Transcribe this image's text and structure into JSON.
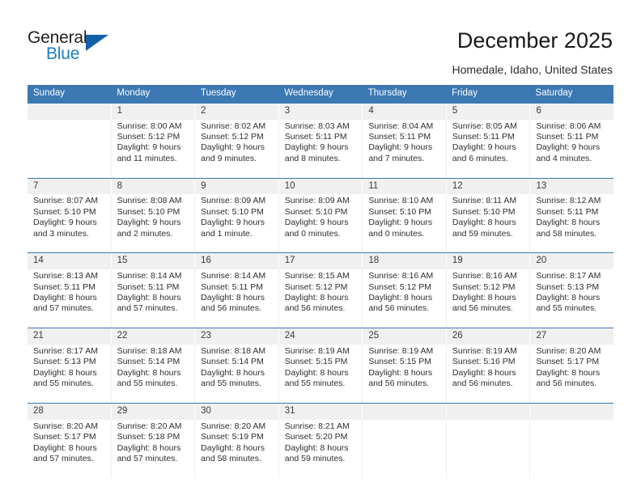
{
  "brand": {
    "name_top": "General",
    "name_bottom": "Blue",
    "triangle_color": "#1061A8",
    "blue_text_color": "#1D7DC4"
  },
  "header": {
    "title": "December 2025",
    "subtitle": "Homedale, Idaho, United States"
  },
  "theme": {
    "header_row_bg": "#3B78B4",
    "header_row_text": "#FFFFFF",
    "day_number_bg": "#F0F0F0",
    "row_divider": "#3B78B4",
    "body_text": "#2E2E2E"
  },
  "calendar": {
    "weekdays": [
      "Sunday",
      "Monday",
      "Tuesday",
      "Wednesday",
      "Thursday",
      "Friday",
      "Saturday"
    ],
    "weeks": [
      [
        {
          "day": "",
          "lines": []
        },
        {
          "day": "1",
          "lines": [
            "Sunrise: 8:00 AM",
            "Sunset: 5:12 PM",
            "Daylight: 9 hours",
            "and 11 minutes."
          ]
        },
        {
          "day": "2",
          "lines": [
            "Sunrise: 8:02 AM",
            "Sunset: 5:12 PM",
            "Daylight: 9 hours",
            "and 9 minutes."
          ]
        },
        {
          "day": "3",
          "lines": [
            "Sunrise: 8:03 AM",
            "Sunset: 5:11 PM",
            "Daylight: 9 hours",
            "and 8 minutes."
          ]
        },
        {
          "day": "4",
          "lines": [
            "Sunrise: 8:04 AM",
            "Sunset: 5:11 PM",
            "Daylight: 9 hours",
            "and 7 minutes."
          ]
        },
        {
          "day": "5",
          "lines": [
            "Sunrise: 8:05 AM",
            "Sunset: 5:11 PM",
            "Daylight: 9 hours",
            "and 6 minutes."
          ]
        },
        {
          "day": "6",
          "lines": [
            "Sunrise: 8:06 AM",
            "Sunset: 5:11 PM",
            "Daylight: 9 hours",
            "and 4 minutes."
          ]
        }
      ],
      [
        {
          "day": "7",
          "lines": [
            "Sunrise: 8:07 AM",
            "Sunset: 5:10 PM",
            "Daylight: 9 hours",
            "and 3 minutes."
          ]
        },
        {
          "day": "8",
          "lines": [
            "Sunrise: 8:08 AM",
            "Sunset: 5:10 PM",
            "Daylight: 9 hours",
            "and 2 minutes."
          ]
        },
        {
          "day": "9",
          "lines": [
            "Sunrise: 8:09 AM",
            "Sunset: 5:10 PM",
            "Daylight: 9 hours",
            "and 1 minute."
          ]
        },
        {
          "day": "10",
          "lines": [
            "Sunrise: 8:09 AM",
            "Sunset: 5:10 PM",
            "Daylight: 9 hours",
            "and 0 minutes."
          ]
        },
        {
          "day": "11",
          "lines": [
            "Sunrise: 8:10 AM",
            "Sunset: 5:10 PM",
            "Daylight: 9 hours",
            "and 0 minutes."
          ]
        },
        {
          "day": "12",
          "lines": [
            "Sunrise: 8:11 AM",
            "Sunset: 5:10 PM",
            "Daylight: 8 hours",
            "and 59 minutes."
          ]
        },
        {
          "day": "13",
          "lines": [
            "Sunrise: 8:12 AM",
            "Sunset: 5:11 PM",
            "Daylight: 8 hours",
            "and 58 minutes."
          ]
        }
      ],
      [
        {
          "day": "14",
          "lines": [
            "Sunrise: 8:13 AM",
            "Sunset: 5:11 PM",
            "Daylight: 8 hours",
            "and 57 minutes."
          ]
        },
        {
          "day": "15",
          "lines": [
            "Sunrise: 8:14 AM",
            "Sunset: 5:11 PM",
            "Daylight: 8 hours",
            "and 57 minutes."
          ]
        },
        {
          "day": "16",
          "lines": [
            "Sunrise: 8:14 AM",
            "Sunset: 5:11 PM",
            "Daylight: 8 hours",
            "and 56 minutes."
          ]
        },
        {
          "day": "17",
          "lines": [
            "Sunrise: 8:15 AM",
            "Sunset: 5:12 PM",
            "Daylight: 8 hours",
            "and 56 minutes."
          ]
        },
        {
          "day": "18",
          "lines": [
            "Sunrise: 8:16 AM",
            "Sunset: 5:12 PM",
            "Daylight: 8 hours",
            "and 56 minutes."
          ]
        },
        {
          "day": "19",
          "lines": [
            "Sunrise: 8:16 AM",
            "Sunset: 5:12 PM",
            "Daylight: 8 hours",
            "and 56 minutes."
          ]
        },
        {
          "day": "20",
          "lines": [
            "Sunrise: 8:17 AM",
            "Sunset: 5:13 PM",
            "Daylight: 8 hours",
            "and 55 minutes."
          ]
        }
      ],
      [
        {
          "day": "21",
          "lines": [
            "Sunrise: 8:17 AM",
            "Sunset: 5:13 PM",
            "Daylight: 8 hours",
            "and 55 minutes."
          ]
        },
        {
          "day": "22",
          "lines": [
            "Sunrise: 8:18 AM",
            "Sunset: 5:14 PM",
            "Daylight: 8 hours",
            "and 55 minutes."
          ]
        },
        {
          "day": "23",
          "lines": [
            "Sunrise: 8:18 AM",
            "Sunset: 5:14 PM",
            "Daylight: 8 hours",
            "and 55 minutes."
          ]
        },
        {
          "day": "24",
          "lines": [
            "Sunrise: 8:19 AM",
            "Sunset: 5:15 PM",
            "Daylight: 8 hours",
            "and 55 minutes."
          ]
        },
        {
          "day": "25",
          "lines": [
            "Sunrise: 8:19 AM",
            "Sunset: 5:15 PM",
            "Daylight: 8 hours",
            "and 56 minutes."
          ]
        },
        {
          "day": "26",
          "lines": [
            "Sunrise: 8:19 AM",
            "Sunset: 5:16 PM",
            "Daylight: 8 hours",
            "and 56 minutes."
          ]
        },
        {
          "day": "27",
          "lines": [
            "Sunrise: 8:20 AM",
            "Sunset: 5:17 PM",
            "Daylight: 8 hours",
            "and 56 minutes."
          ]
        }
      ],
      [
        {
          "day": "28",
          "lines": [
            "Sunrise: 8:20 AM",
            "Sunset: 5:17 PM",
            "Daylight: 8 hours",
            "and 57 minutes."
          ]
        },
        {
          "day": "29",
          "lines": [
            "Sunrise: 8:20 AM",
            "Sunset: 5:18 PM",
            "Daylight: 8 hours",
            "and 57 minutes."
          ]
        },
        {
          "day": "30",
          "lines": [
            "Sunrise: 8:20 AM",
            "Sunset: 5:19 PM",
            "Daylight: 8 hours",
            "and 58 minutes."
          ]
        },
        {
          "day": "31",
          "lines": [
            "Sunrise: 8:21 AM",
            "Sunset: 5:20 PM",
            "Daylight: 8 hours",
            "and 59 minutes."
          ]
        },
        {
          "day": "",
          "lines": []
        },
        {
          "day": "",
          "lines": []
        },
        {
          "day": "",
          "lines": []
        }
      ]
    ]
  }
}
